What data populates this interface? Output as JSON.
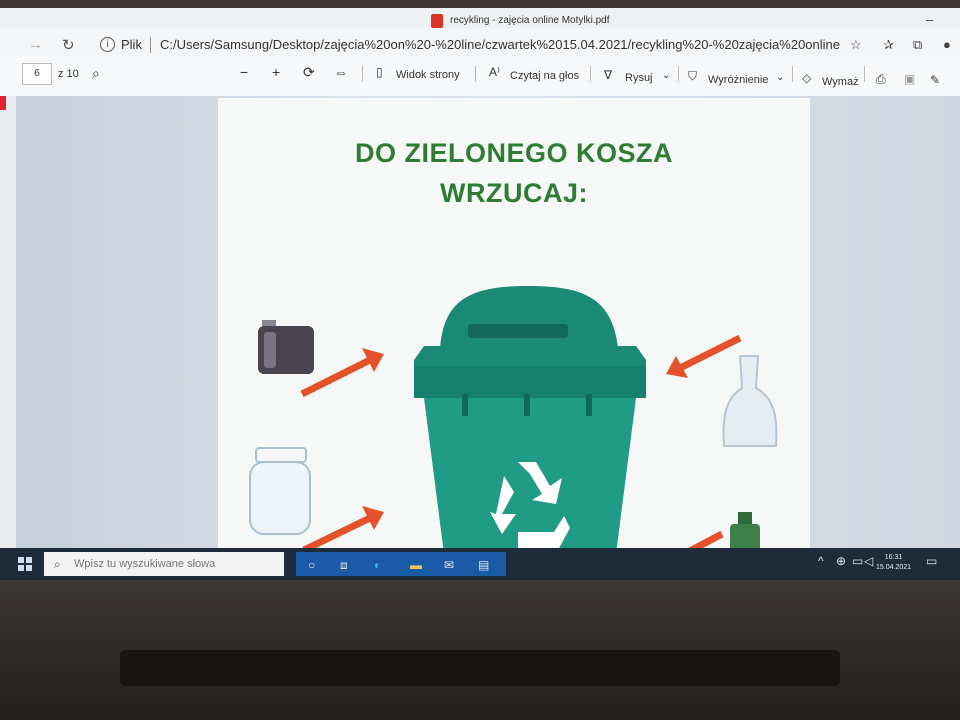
{
  "window": {
    "title": "recykling - zajęcia online Motylki.pdf"
  },
  "address_bar": {
    "scheme_label": "Plik",
    "url": "C:/Users/Samsung/Desktop/zajęcia%20on%20-%20line/czwartek%2015.04.2021/recykling%20-%20zajęcia%20online%20Moty..."
  },
  "pdf_toolbar": {
    "current_page": "6",
    "total_pages": "z 10",
    "page_view_label": "Widok strony",
    "read_aloud_label": "Czytaj na głos",
    "draw_label": "Rysuj",
    "highlight_label": "Wyróżnienie",
    "erase_label": "Wymaż"
  },
  "document": {
    "heading_line1": "DO ZIELONEGO KOSZA",
    "heading_line2": "WRZUCAJ:"
  },
  "taskbar": {
    "search_placeholder": "Wpisz tu wyszukiwane słowa",
    "time": "16:31",
    "date": "15.04.2021"
  },
  "colors": {
    "heading": "#2e7d32",
    "bin": "#1f9b86",
    "bin_lid": "#1a8a74",
    "arrow": "#e4512b",
    "taskbar": "#1d2b3a"
  }
}
